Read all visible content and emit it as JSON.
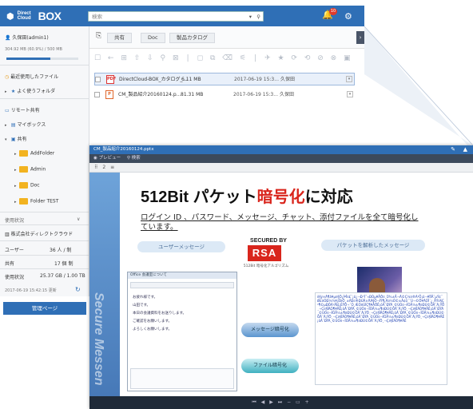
{
  "app": {
    "logo_small": "Direct Cloud",
    "logo_big": "BOX",
    "search_placeholder": "検索",
    "notification_count": "10"
  },
  "sidebar": {
    "user": "久保田(admin1)",
    "usage_text": "304.92 MB (60.9%) / 500 MB",
    "usage_fraction": 0.609,
    "recent": "最近使用したファイル",
    "favorites": "よく使うフォルダ",
    "share_link": "リモート共有",
    "mybox": "マイボックス",
    "shared": "共有",
    "folders": [
      "AddFolder",
      "Admin",
      "Doc",
      "Folder TEST"
    ],
    "status_header": "使用状況",
    "company": "株式会社ディレクトクラウド",
    "stats": [
      {
        "label": "ユーザー",
        "value": "36 人 / 制"
      },
      {
        "label": "共有",
        "value": "17 個 制"
      },
      {
        "label": "使用状況",
        "value": "25.37 GB / 1.00 TB"
      }
    ],
    "updated": "2017-06-19 15:42:15 更新",
    "admin_button": "管理ページ"
  },
  "breadcrumb": [
    "共有",
    "Doc",
    "製品カタログ"
  ],
  "files": [
    {
      "name": "DirectCloud-BOX_カタログ_...",
      "size": "6.11 MB",
      "date": "2017-06-19 15:3...",
      "user": "久保田"
    },
    {
      "name": "CM_製品紹介20160124.p...",
      "size": "81.31 MB",
      "date": "2017-06-19 15:3...",
      "user": "久保田"
    }
  ],
  "viewer": {
    "filename": "CM_製品紹介20160124.pptx",
    "preview_label": "プレビュー",
    "search_label": "検索",
    "page_label": "2",
    "slide": {
      "title_a": "512Bit パケット",
      "title_red": "暗号化",
      "title_b": "に対応",
      "desc": "ログイン ID 、パスワード、メッセージ、チャット、添付ファイルを全て暗号化しています。",
      "left_pill": "ユーザーメッセージ",
      "right_pill": "パケットを解析したメッセージ",
      "secured_by": "SECURED BY",
      "rsa": "RSA",
      "rsa_sub": "512Bit 暗号化アルゴリズム",
      "arrow_msg": "メッセージ暗号化",
      "arrow_file": "ファイル暗号化",
      "side_text": "Secure Messen",
      "chat_lines": [
        "Office 会議室について",
        "お疲れ様です。",
        "山田です。",
        "本日の会議資料をお送りします。",
        "ご確認をお願いします。",
        "よろしくお願いします。"
      ]
    }
  }
}
